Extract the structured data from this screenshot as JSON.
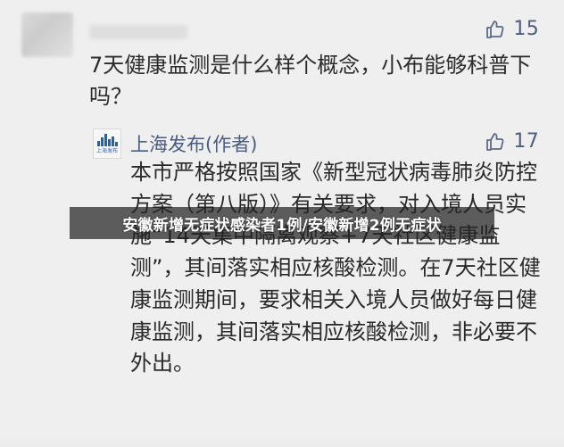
{
  "comment_1": {
    "likes": "15",
    "question": "7天健康监测是什么样个概念，小布能够科普下吗？",
    "avatar": "blurred-avatar",
    "name": "blurred-user-name"
  },
  "comment_2": {
    "author": "上海发布(作者)",
    "logo_text": "上海发布",
    "likes": "17",
    "answer": "本市严格按照国家《新型冠状病毒肺炎防控方案（第八版）》有关要求，对入境人员实施“14天集中隔离观察+7天社区健康监测”，其间落实相应核酸检测。在7天社区健康监测期间，要求相关入境人员做好每日健康监测，其间落实相应核酸检测，非必要不外出。"
  },
  "banner": {
    "text": "安徽新增无症状感染者1例/安徽新增2例无症状"
  },
  "icons": {
    "like": "thumbs-up-icon",
    "logo": "shanghai-fabu-logo-icon"
  },
  "colors": {
    "background": "#efefef",
    "icon": "#5b6b86",
    "author": "#4a5c80",
    "banner_bg": "#232323"
  }
}
